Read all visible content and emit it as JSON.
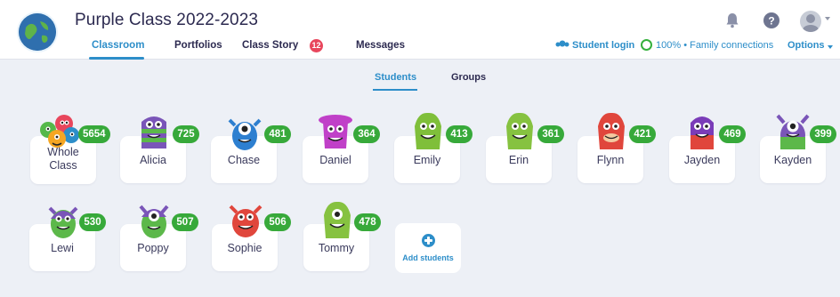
{
  "header": {
    "class_title": "Purple Class 2022-2023",
    "nav": [
      {
        "label": "Classroom",
        "active": true
      },
      {
        "label": "Portfolios",
        "active": false
      },
      {
        "label": "Class Story",
        "active": false,
        "badge": "12"
      },
      {
        "label": "Messages",
        "active": false
      }
    ],
    "icons": [
      "bell-icon",
      "help-icon",
      "user-avatar-icon"
    ],
    "student_login": "Student login",
    "family_connections": "100% • Family connections",
    "options": "Options"
  },
  "subtabs": [
    {
      "label": "Students",
      "active": true
    },
    {
      "label": "Groups",
      "active": false
    }
  ],
  "students": [
    {
      "name": "Whole Class",
      "points": "5654"
    },
    {
      "name": "Alicia",
      "points": "725"
    },
    {
      "name": "Chase",
      "points": "481"
    },
    {
      "name": "Daniel",
      "points": "364"
    },
    {
      "name": "Emily",
      "points": "413"
    },
    {
      "name": "Erin",
      "points": "361"
    },
    {
      "name": "Flynn",
      "points": "421"
    },
    {
      "name": "Jayden",
      "points": "469"
    },
    {
      "name": "Kayden",
      "points": "399"
    },
    {
      "name": "Lewi",
      "points": "530"
    },
    {
      "name": "Poppy",
      "points": "507"
    },
    {
      "name": "Sophie",
      "points": "506"
    },
    {
      "name": "Tommy",
      "points": "478"
    }
  ],
  "add_students": "Add students",
  "colors": {
    "accent": "#2d8ec9",
    "points_badge": "#37a93a",
    "badge_red": "#e8465c",
    "background": "#edf0f6"
  }
}
